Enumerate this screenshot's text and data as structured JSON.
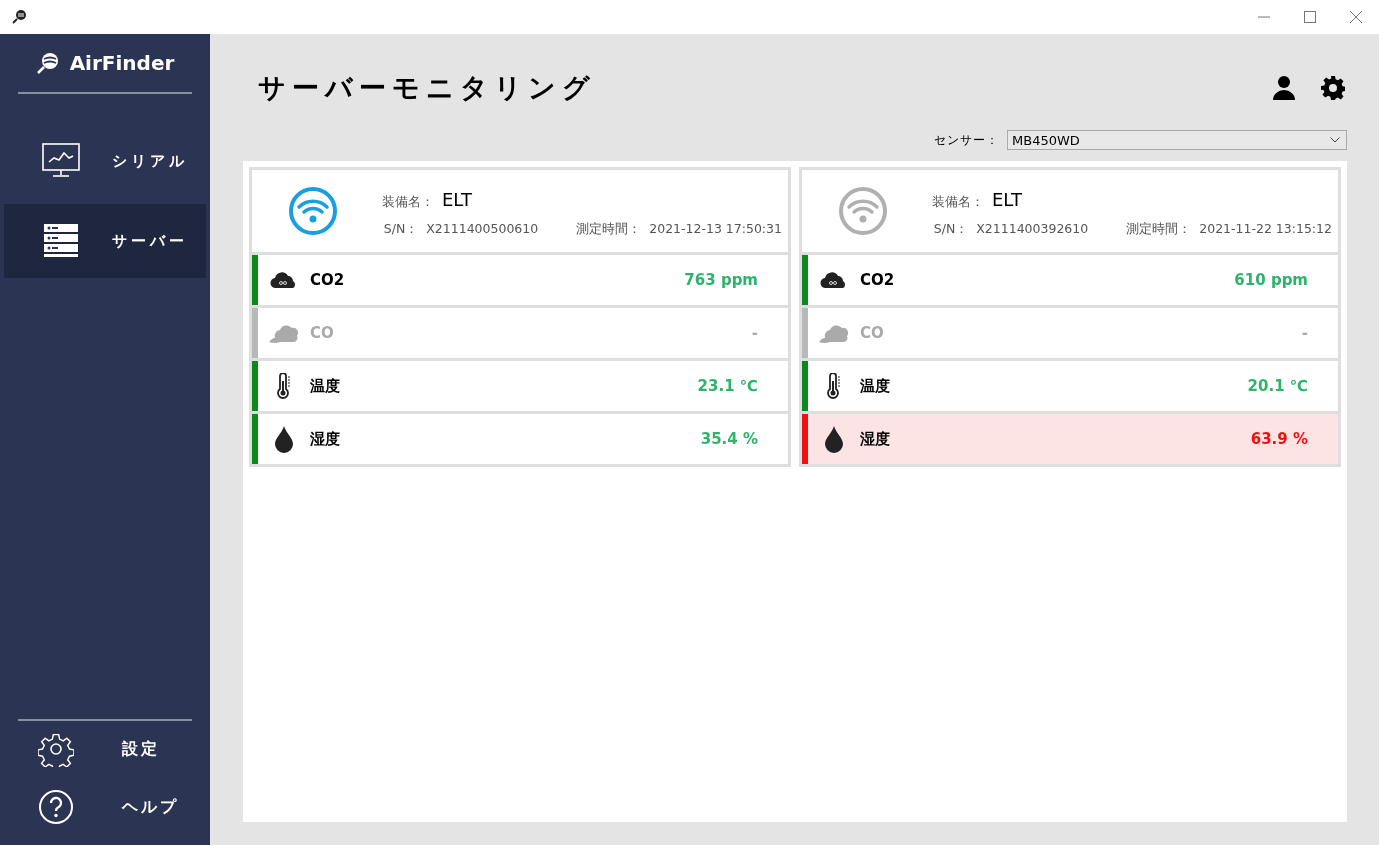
{
  "sidebar": {
    "brand": "AirFinder",
    "items": [
      {
        "kind": "chart",
        "label": "シリアル",
        "selected": false
      },
      {
        "kind": "server",
        "label": "サーバー",
        "selected": true
      }
    ],
    "footer_items": [
      {
        "kind": "settings",
        "label": "設定"
      },
      {
        "kind": "help",
        "label": "ヘルプ"
      }
    ]
  },
  "page_title": "サーバーモニタリング",
  "sensor": {
    "label": "センサー：",
    "value": "MB450WD"
  },
  "devices": [
    {
      "connected": true,
      "name_label": "装備名：",
      "name": "ELT",
      "sn_label": "S/N：",
      "sn": "X2111400500610",
      "time_label": "測定時間：",
      "time": "2021-12-13 17:50:31",
      "readings": [
        {
          "kind": "co2",
          "label": "CO2",
          "value": "763 ppm",
          "active": true,
          "alert": false
        },
        {
          "kind": "co",
          "label": "CO",
          "value": "-",
          "active": false,
          "alert": false
        },
        {
          "kind": "temperature",
          "label": "温度",
          "value": "23.1 ℃",
          "active": true,
          "alert": false
        },
        {
          "kind": "humidity",
          "label": "湿度",
          "value": "35.4 %",
          "active": true,
          "alert": false
        }
      ]
    },
    {
      "connected": false,
      "name_label": "装備名：",
      "name": "ELT",
      "sn_label": "S/N：",
      "sn": "X2111400392610",
      "time_label": "測定時間：",
      "time": "2021-11-22 13:15:12",
      "readings": [
        {
          "kind": "co2",
          "label": "CO2",
          "value": "610 ppm",
          "active": true,
          "alert": false
        },
        {
          "kind": "co",
          "label": "CO",
          "value": "-",
          "active": false,
          "alert": false
        },
        {
          "kind": "temperature",
          "label": "温度",
          "value": "20.1 ℃",
          "active": true,
          "alert": false
        },
        {
          "kind": "humidity",
          "label": "湿度",
          "value": "63.9 %",
          "active": true,
          "alert": true
        }
      ]
    }
  ]
}
